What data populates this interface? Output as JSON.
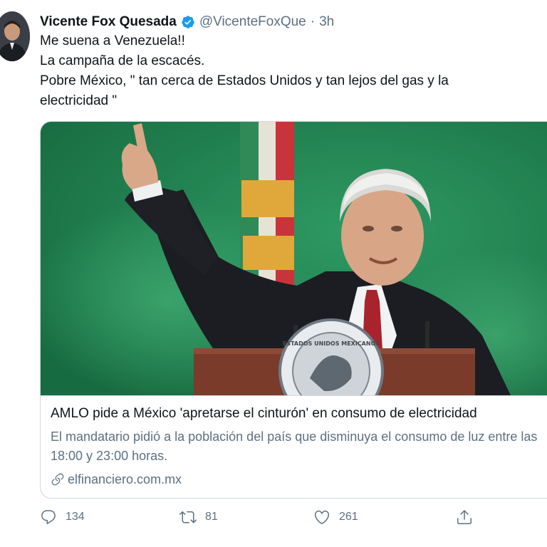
{
  "author": {
    "name": "Vicente Fox Quesada",
    "handle": "@VicenteFoxQue",
    "separator": "·",
    "time": "3h",
    "verified_color": "#1d9bf0"
  },
  "tweet": {
    "lines": [
      "Me suena a Venezuela!!",
      "La campaña de la escacés.",
      "Pobre México, \" tan cerca de Estados Unidos y tan lejos del gas y la",
      "electricidad \""
    ]
  },
  "card": {
    "title": "AMLO pide a México 'apretarse el cinturón' en consumo de electricidad",
    "description": "El mandatario pidió a la población del país que disminuya el consumo de luz entre las 18:00 y 23:00 horas.",
    "link": "elfinanciero.com.mx",
    "image_seal_text": "ESTADOS UNIDOS MEXICANOS"
  },
  "actions": {
    "replies": "134",
    "retweets": "81",
    "likes": "261"
  },
  "colors": {
    "text": "#0f1419",
    "secondary": "#5b7083",
    "border": "#cfd9de",
    "background_green": "#1f7a4d"
  }
}
